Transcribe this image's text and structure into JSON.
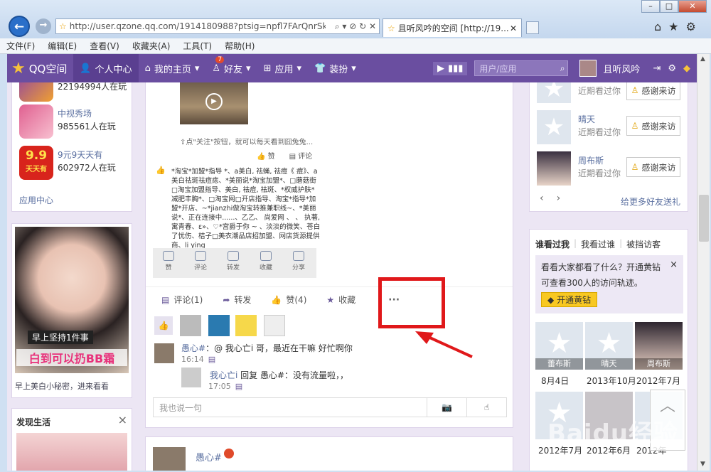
{
  "browser": {
    "url": "http://user.qzone.qq.com/1914180988?ptsig=npfl7FArQnrSkt6vs",
    "tab_title": "且听风吟的空间 [http://19...",
    "menu": [
      "文件(F)",
      "编辑(E)",
      "查看(V)",
      "收藏夹(A)",
      "工具(T)",
      "帮助(H)"
    ]
  },
  "qzone_nav": {
    "logo": "QQ空间",
    "items": [
      "个人中心",
      "我的主页",
      "好友",
      "应用",
      "装扮"
    ],
    "friend_badge": "7",
    "search_placeholder": "用户/应用",
    "username": "且听风吟"
  },
  "left": {
    "games": [
      {
        "name": "",
        "players": "22194994人在玩"
      },
      {
        "name": "中视秀场",
        "players": "985561人在玩"
      },
      {
        "name": "9元9天天有",
        "players": "602972人在玩"
      }
    ],
    "game_icon3_text": "9.9",
    "game_icon3_sub": "天天有",
    "app_center": "应用中心",
    "ad_caption1": "早上坚持1件事",
    "ad_caption2": "白到可以扔BB霜",
    "ad_desc": "早上美白小秘密，进来看看",
    "discover_title": "发现生活",
    "discover_close": "×"
  },
  "feed": {
    "share_hint": "点\"关注\"按钮，就可以每天看到囧兔兔...",
    "like_label": "赞",
    "comment_label": "评论",
    "post_text": "*淘宝*加盟*指导 *、a美白, 祛蝇, 祛痘《 痘》、a美白祛斑祛痘痣、*美丽说*淘宝加盟*、□蘑菇街□淘宝加盟指导、美白, 祛痘, 祛斑、*权威护肤*减肥丰胸*、□淘宝网□开店指导、淘宝*指导*加盟*开店、~*jianzhi做淘宝转推兼职线~、*美丽说*、正在连接中......、乙乙、 尚爱网 、 、 执著, 寓青春、ε»、♡*宫爵于你 ~ 、淡淡的微笑、苍白了忧伤、桔子□美衣潮品店招加盟、网店货源提供商、li ying",
    "share_icons": [
      "赞",
      "评论",
      "转发",
      "收藏",
      "分享"
    ],
    "actions": {
      "comment": "评论(1)",
      "forward": "转发",
      "like": "赞(4)",
      "collect": "收藏",
      "more": "···"
    },
    "comments": [
      {
        "author": "愚心#",
        "text": "：@ 我心亡i 哥，最近在干嘛 好忙啊你",
        "time": "16:14"
      },
      {
        "author": "我心亡i",
        "text": "回复 愚心#：没有流量啦，，",
        "time": "17:05"
      }
    ],
    "comment_placeholder": "我也说一句",
    "next_author": "愚心#"
  },
  "right": {
    "recent": [
      {
        "name": "",
        "sub": "近期看过你",
        "btn": "感谢来访"
      },
      {
        "name": "晴天",
        "sub": "近期看过你",
        "btn": "感谢来访"
      },
      {
        "name": "周布斯",
        "sub": "近期看过你",
        "btn": "感谢来访"
      }
    ],
    "more_gifts": "给更多好友送礼",
    "tabs": [
      "谁看过我",
      "我看过谁",
      "被挡访客"
    ],
    "promo_line1": "看看大家都看了什么？开通黄钻",
    "promo_line2": "可查看300人的访问轨迹。",
    "promo_close": "×",
    "promo_btn": "开通黄钻",
    "visitors": [
      {
        "name": "蕾布斯",
        "date": "8月4日"
      },
      {
        "name": "晴天",
        "date": "2013年10月"
      },
      {
        "name": "周布斯",
        "date": "2012年7月"
      },
      {
        "name": "",
        "date": "2012年7月"
      },
      {
        "name": "",
        "date": "2012年6月"
      },
      {
        "name": "",
        "date": "2012年"
      }
    ]
  },
  "watermark": "Baidu经验"
}
